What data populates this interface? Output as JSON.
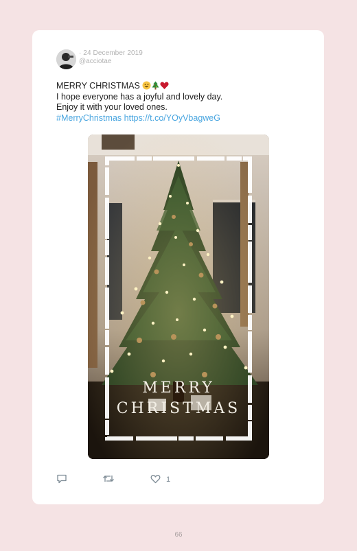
{
  "tweet": {
    "date": "· 24 December 2019",
    "handle": "@acciotae",
    "line1": "MERRY CHRISTMAS",
    "line2": "I hope everyone has a joyful and lovely day.",
    "line3": "Enjoy it with your loved ones.",
    "hashtag": "#MerryChristmas",
    "url": "https://t.co/YOyVbagweG",
    "emojis": [
      "grinning-face-icon",
      "christmas-tree-icon",
      "red-heart-icon"
    ]
  },
  "media": {
    "overlay_line1": "MERRY",
    "overlay_line2": "CHRISTMAS"
  },
  "actions": {
    "reply_icon": "reply-icon",
    "retweet_icon": "retweet-icon",
    "like_icon": "heart-icon",
    "like_count": "1"
  },
  "page": {
    "number": "66"
  },
  "colors": {
    "background": "#f5e3e4",
    "card": "#ffffff",
    "link": "#4aa6e0",
    "meta_text": "#b3b3b3",
    "icon": "#7c8a94"
  }
}
